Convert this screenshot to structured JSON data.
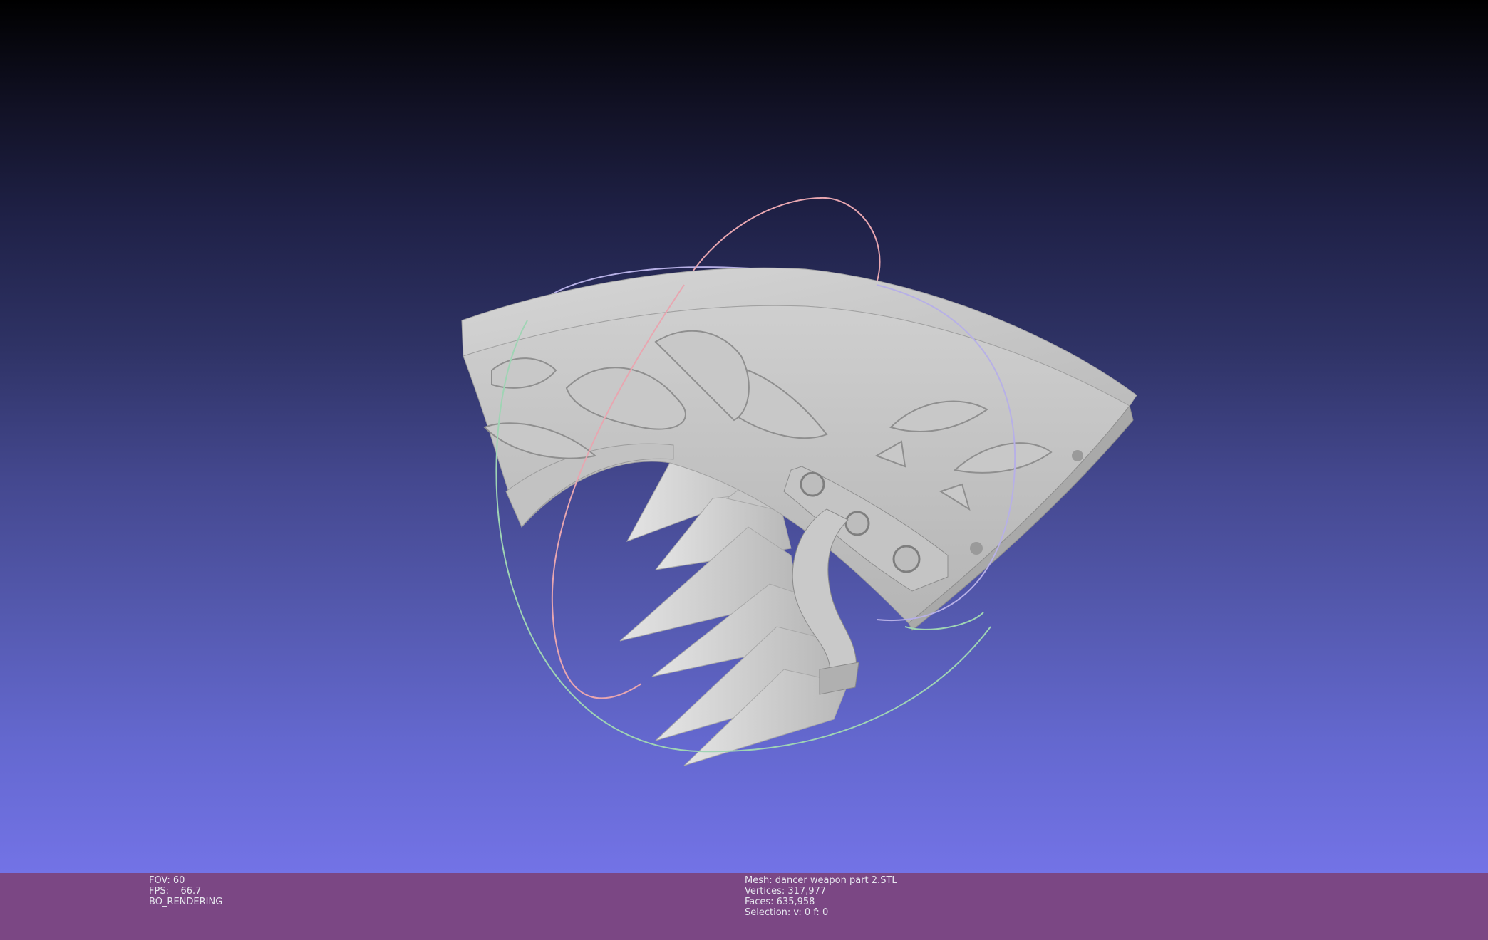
{
  "viewport": {
    "background_top": "#000000",
    "background_bottom": "#7373e6",
    "model_color": "#d4d4d4",
    "trackball_ring_colors": [
      "#e8a6b0",
      "#b7b0e6",
      "#9fd4b4"
    ]
  },
  "status": {
    "fov": "FOV: 60",
    "fps": "FPS:    66.7",
    "render_mode": "BO_RENDERING",
    "mesh": "Mesh: dancer weapon part 2.STL",
    "vertices": "Vertices: 317,977",
    "faces": "Faces: 635,958",
    "selection": "Selection: v: 0 f: 0"
  }
}
